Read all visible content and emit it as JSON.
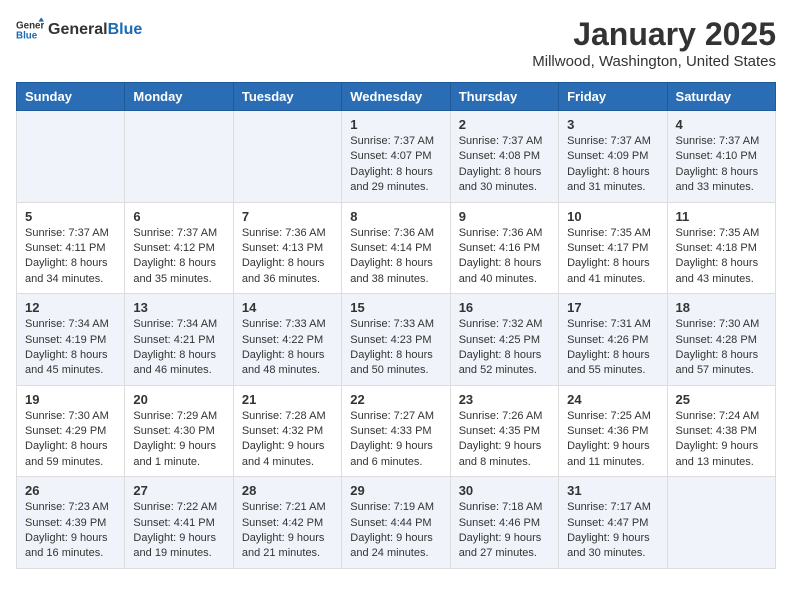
{
  "header": {
    "logo_general": "General",
    "logo_blue": "Blue",
    "title": "January 2025",
    "subtitle": "Millwood, Washington, United States"
  },
  "days_of_week": [
    "Sunday",
    "Monday",
    "Tuesday",
    "Wednesday",
    "Thursday",
    "Friday",
    "Saturday"
  ],
  "weeks": [
    [
      {
        "day": "",
        "content": ""
      },
      {
        "day": "",
        "content": ""
      },
      {
        "day": "",
        "content": ""
      },
      {
        "day": "1",
        "content": "Sunrise: 7:37 AM\nSunset: 4:07 PM\nDaylight: 8 hours and 29 minutes."
      },
      {
        "day": "2",
        "content": "Sunrise: 7:37 AM\nSunset: 4:08 PM\nDaylight: 8 hours and 30 minutes."
      },
      {
        "day": "3",
        "content": "Sunrise: 7:37 AM\nSunset: 4:09 PM\nDaylight: 8 hours and 31 minutes."
      },
      {
        "day": "4",
        "content": "Sunrise: 7:37 AM\nSunset: 4:10 PM\nDaylight: 8 hours and 33 minutes."
      }
    ],
    [
      {
        "day": "5",
        "content": "Sunrise: 7:37 AM\nSunset: 4:11 PM\nDaylight: 8 hours and 34 minutes."
      },
      {
        "day": "6",
        "content": "Sunrise: 7:37 AM\nSunset: 4:12 PM\nDaylight: 8 hours and 35 minutes."
      },
      {
        "day": "7",
        "content": "Sunrise: 7:36 AM\nSunset: 4:13 PM\nDaylight: 8 hours and 36 minutes."
      },
      {
        "day": "8",
        "content": "Sunrise: 7:36 AM\nSunset: 4:14 PM\nDaylight: 8 hours and 38 minutes."
      },
      {
        "day": "9",
        "content": "Sunrise: 7:36 AM\nSunset: 4:16 PM\nDaylight: 8 hours and 40 minutes."
      },
      {
        "day": "10",
        "content": "Sunrise: 7:35 AM\nSunset: 4:17 PM\nDaylight: 8 hours and 41 minutes."
      },
      {
        "day": "11",
        "content": "Sunrise: 7:35 AM\nSunset: 4:18 PM\nDaylight: 8 hours and 43 minutes."
      }
    ],
    [
      {
        "day": "12",
        "content": "Sunrise: 7:34 AM\nSunset: 4:19 PM\nDaylight: 8 hours and 45 minutes."
      },
      {
        "day": "13",
        "content": "Sunrise: 7:34 AM\nSunset: 4:21 PM\nDaylight: 8 hours and 46 minutes."
      },
      {
        "day": "14",
        "content": "Sunrise: 7:33 AM\nSunset: 4:22 PM\nDaylight: 8 hours and 48 minutes."
      },
      {
        "day": "15",
        "content": "Sunrise: 7:33 AM\nSunset: 4:23 PM\nDaylight: 8 hours and 50 minutes."
      },
      {
        "day": "16",
        "content": "Sunrise: 7:32 AM\nSunset: 4:25 PM\nDaylight: 8 hours and 52 minutes."
      },
      {
        "day": "17",
        "content": "Sunrise: 7:31 AM\nSunset: 4:26 PM\nDaylight: 8 hours and 55 minutes."
      },
      {
        "day": "18",
        "content": "Sunrise: 7:30 AM\nSunset: 4:28 PM\nDaylight: 8 hours and 57 minutes."
      }
    ],
    [
      {
        "day": "19",
        "content": "Sunrise: 7:30 AM\nSunset: 4:29 PM\nDaylight: 8 hours and 59 minutes."
      },
      {
        "day": "20",
        "content": "Sunrise: 7:29 AM\nSunset: 4:30 PM\nDaylight: 9 hours and 1 minute."
      },
      {
        "day": "21",
        "content": "Sunrise: 7:28 AM\nSunset: 4:32 PM\nDaylight: 9 hours and 4 minutes."
      },
      {
        "day": "22",
        "content": "Sunrise: 7:27 AM\nSunset: 4:33 PM\nDaylight: 9 hours and 6 minutes."
      },
      {
        "day": "23",
        "content": "Sunrise: 7:26 AM\nSunset: 4:35 PM\nDaylight: 9 hours and 8 minutes."
      },
      {
        "day": "24",
        "content": "Sunrise: 7:25 AM\nSunset: 4:36 PM\nDaylight: 9 hours and 11 minutes."
      },
      {
        "day": "25",
        "content": "Sunrise: 7:24 AM\nSunset: 4:38 PM\nDaylight: 9 hours and 13 minutes."
      }
    ],
    [
      {
        "day": "26",
        "content": "Sunrise: 7:23 AM\nSunset: 4:39 PM\nDaylight: 9 hours and 16 minutes."
      },
      {
        "day": "27",
        "content": "Sunrise: 7:22 AM\nSunset: 4:41 PM\nDaylight: 9 hours and 19 minutes."
      },
      {
        "day": "28",
        "content": "Sunrise: 7:21 AM\nSunset: 4:42 PM\nDaylight: 9 hours and 21 minutes."
      },
      {
        "day": "29",
        "content": "Sunrise: 7:19 AM\nSunset: 4:44 PM\nDaylight: 9 hours and 24 minutes."
      },
      {
        "day": "30",
        "content": "Sunrise: 7:18 AM\nSunset: 4:46 PM\nDaylight: 9 hours and 27 minutes."
      },
      {
        "day": "31",
        "content": "Sunrise: 7:17 AM\nSunset: 4:47 PM\nDaylight: 9 hours and 30 minutes."
      },
      {
        "day": "",
        "content": ""
      }
    ]
  ]
}
